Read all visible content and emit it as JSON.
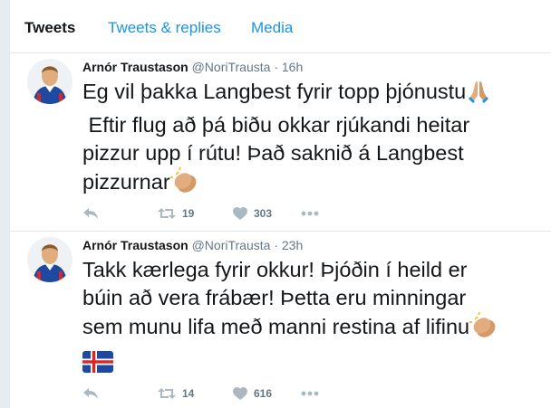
{
  "tabs": [
    {
      "label": "Tweets",
      "active": true
    },
    {
      "label": "Tweets & replies",
      "active": false
    },
    {
      "label": "Media",
      "active": false
    }
  ],
  "tweets": [
    {
      "name": "Arnór Traustason",
      "handle": "@NoriTrausta",
      "separator": "·",
      "time": "16h",
      "lines": [
        "Eg vil þakka Langbest fyrir topp þjónustu",
        " Eftir flug að þá biðu okkar rjúkandi heitar",
        "pizzur upp í rútu! Það saknið á Langbest",
        "pizzurnar"
      ],
      "emojis": [
        "folded-hands",
        "clapping-hands"
      ],
      "retweets": "19",
      "likes": "303"
    },
    {
      "name": "Arnór Traustason",
      "handle": "@NoriTrausta",
      "separator": "·",
      "time": "23h",
      "lines": [
        "Takk kærlega fyrir okkur! Þjóðin í heild er",
        "búin að vera frábær! Þetta eru minningar",
        "sem munu lifa með manni restina af lifinu"
      ],
      "emojis": [
        "clapping-hands",
        "iceland-flag"
      ],
      "retweets": "14",
      "likes": "616"
    }
  ],
  "colors": {
    "link": "#1b95e0",
    "text": "#14171a",
    "muted": "#657786",
    "icon": "#aab8c2",
    "skin": "#e2ad7e",
    "jersey": "#1d4aa0"
  }
}
